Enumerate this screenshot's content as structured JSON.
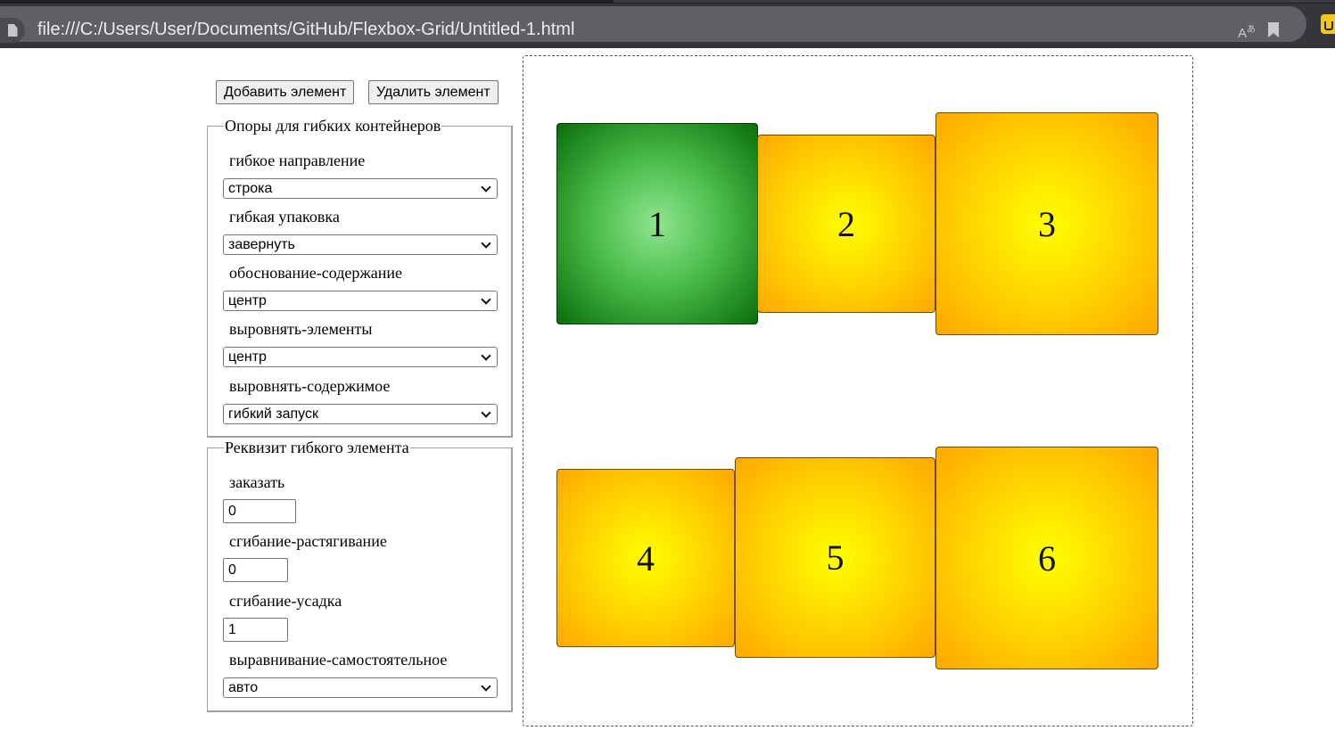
{
  "browser": {
    "url": "file:///C:/Users/User/Documents/GitHub/Flexbox-Grid/Untitled-1.html",
    "icons": [
      "page-icon",
      "translate-icon",
      "bookmark-icon",
      "extension-icon"
    ]
  },
  "toolbar": {
    "add_label": "Добавить элемент",
    "remove_label": "Удалить элемент"
  },
  "container_props": {
    "legend": "Опоры для гибких контейнеров",
    "flex_direction": {
      "label": "гибкое направление",
      "value": "строка"
    },
    "flex_wrap": {
      "label": "гибкая упаковка",
      "value": "завернуть"
    },
    "justify_content": {
      "label": "обоснование-содержание",
      "value": "центр"
    },
    "align_items": {
      "label": "выровнять-элементы",
      "value": "центр"
    },
    "align_content": {
      "label": "выровнять-содержимое",
      "value": "гибкий запуск"
    }
  },
  "item_props": {
    "legend": "Реквизит гибкого элемента",
    "order": {
      "label": "заказать",
      "value": "0"
    },
    "flex_grow": {
      "label": "сгибание-растягивание",
      "value": "0"
    },
    "flex_shrink": {
      "label": "сгибание-усадка",
      "value": "1"
    },
    "align_self": {
      "label": "выравнивание-самостоятельное",
      "value": "авто"
    }
  },
  "flex_items": [
    {
      "label": "1",
      "selected": true,
      "color": "#4cbc4c"
    },
    {
      "label": "2",
      "selected": false,
      "color": "#ffd800"
    },
    {
      "label": "3",
      "selected": false,
      "color": "#ffd800"
    },
    {
      "label": "4",
      "selected": false,
      "color": "#ffd800"
    },
    {
      "label": "5",
      "selected": false,
      "color": "#ffd800"
    },
    {
      "label": "6",
      "selected": false,
      "color": "#ffd800"
    }
  ]
}
